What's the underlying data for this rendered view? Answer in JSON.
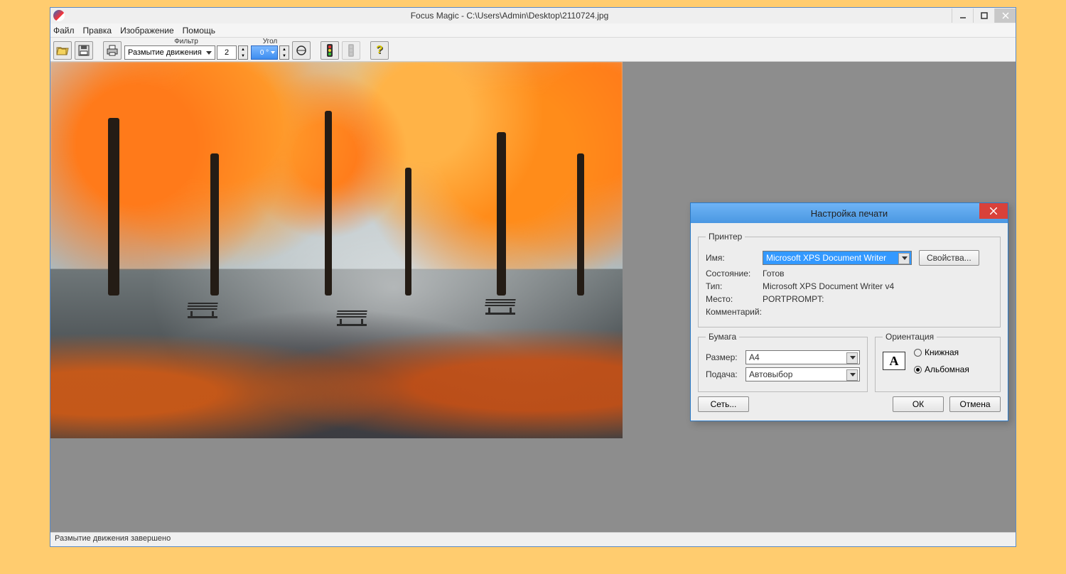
{
  "window": {
    "title": "Focus Magic - C:\\Users\\Admin\\Desktop\\2110724.jpg"
  },
  "menu": {
    "file": "Файл",
    "edit": "Правка",
    "image": "Изображение",
    "help": "Помощь"
  },
  "toolbar": {
    "filter_label": "Фильтр",
    "filter_value": "Размытие движения",
    "amount_value": "2",
    "angle_label": "Угол",
    "angle_value": "0 °"
  },
  "status": {
    "text": "Размытие движения завершено"
  },
  "dialog": {
    "title": "Настройка печати",
    "printer": {
      "legend": "Принтер",
      "name_label": "Имя:",
      "name_value": "Microsoft XPS Document Writer",
      "properties_btn": "Свойства...",
      "state_label": "Состояние:",
      "state_value": "Готов",
      "type_label": "Тип:",
      "type_value": "Microsoft XPS Document Writer v4",
      "where_label": "Место:",
      "where_value": "PORTPROMPT:",
      "comment_label": "Комментарий:",
      "comment_value": ""
    },
    "paper": {
      "legend": "Бумага",
      "size_label": "Размер:",
      "size_value": "A4",
      "source_label": "Подача:",
      "source_value": "Автовыбор"
    },
    "orientation": {
      "legend": "Ориентация",
      "icon_letter": "A",
      "portrait": "Книжная",
      "landscape": "Альбомная",
      "selected": "landscape"
    },
    "buttons": {
      "network": "Сеть...",
      "ok": "ОК",
      "cancel": "Отмена"
    }
  }
}
